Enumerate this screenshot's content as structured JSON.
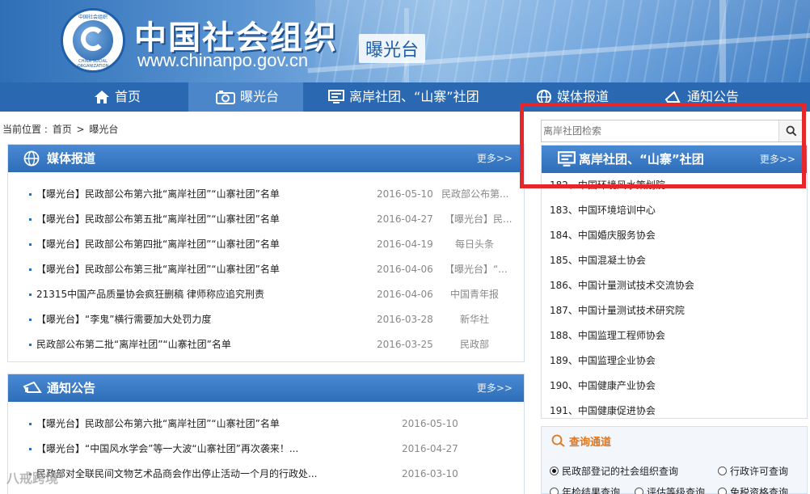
{
  "header": {
    "site_title": "中国社会组织",
    "site_url": "www.chinanpo.gov.cn",
    "section_tag": "曝光台",
    "logo_ring_top": "中国社会组织",
    "logo_ring_bottom": "CHINA SOCIAL ORGANIZATION"
  },
  "nav": {
    "items": [
      {
        "label": "首页",
        "icon": "home-icon"
      },
      {
        "label": "曝光台",
        "icon": "camera-icon",
        "active": true
      },
      {
        "label": "离岸社团、“山寨”社团",
        "icon": "monitor-icon"
      },
      {
        "label": "媒体报道",
        "icon": "globe-icon"
      },
      {
        "label": "通知公告",
        "icon": "megaphone-icon"
      }
    ]
  },
  "breadcrumb": {
    "prefix": "当前位置 :",
    "home": "首页",
    "sep": ">",
    "current": "曝光台"
  },
  "media_panel": {
    "title": "媒体报道",
    "more": "更多>>",
    "rows": [
      {
        "title": "【曝光台】民政部公布第六批“离岸社团”“山寨社团”名单",
        "date": "2016-05-10",
        "source": "民政部公布第..."
      },
      {
        "title": "【曝光台】民政部公布第五批“离岸社团”“山寨社团”名单",
        "date": "2016-04-27",
        "source": "【曝光台】民..."
      },
      {
        "title": "【曝光台】民政部公布第四批“离岸社团”“山寨社团”名单",
        "date": "2016-04-19",
        "source": "每日头条"
      },
      {
        "title": "【曝光台】民政部公布第三批“离岸社团”“山寨社团”名单",
        "date": "2016-04-06",
        "source": "【曝光台】“..."
      },
      {
        "title": "21315中国产品质量协会疯狂删稿 律师称应追究刑责",
        "date": "2016-04-06",
        "source": "中国青年报"
      },
      {
        "title": "【曝光台】“李鬼”横行需要加大处罚力度",
        "date": "2016-03-28",
        "source": "新华社"
      },
      {
        "title": "民政部公布第二批“离岸社团”“山寨社团”名单",
        "date": "2016-03-25",
        "source": "民政部"
      }
    ]
  },
  "notice_panel": {
    "title": "通知公告",
    "more": "更多>>",
    "rows": [
      {
        "title": "【曝光台】民政部公布第六批“离岸社团”“山寨社团”名单",
        "date": "2016-05-10"
      },
      {
        "title": "【曝光台】“中国风水学会”等一大波“山寨社团”再次袭来！...",
        "date": "2016-04-27"
      },
      {
        "title": "民政部对全联民间文物艺术品商会作出停止活动一个月的行政处...",
        "date": "2016-03-10"
      }
    ]
  },
  "search": {
    "placeholder": "离岸社团检索"
  },
  "org_panel": {
    "title": "离岸社团、“山寨”社团",
    "more": "更多>>",
    "rows": [
      "182、中国环境风水策划院",
      "183、中国环境培训中心",
      "184、中国婚庆服务协会",
      "185、中国混凝土协会",
      "186、中国计量测试技术交流协会",
      "187、中国计量测试技术研究院",
      "188、中国监理工程师协会",
      "189、中国监理企业协会",
      "190、中国健康产业协会",
      "191、中国健康促进协会"
    ]
  },
  "query_panel": {
    "title": "查询通道",
    "options": [
      {
        "label": "民政部登记的社会组织查询",
        "checked": true
      },
      {
        "label": "行政许可查询",
        "checked": false
      },
      {
        "label": "年检结果查询",
        "checked": false
      },
      {
        "label": "评估等级查询",
        "checked": false
      },
      {
        "label": "免税资格查询",
        "checked": false
      }
    ]
  },
  "watermark": "八戒跨境",
  "colors": {
    "nav_bg": "#2a68b1",
    "panel_head": "#2e6db8",
    "highlight": "#e5262b",
    "query_title": "#e0761e"
  }
}
